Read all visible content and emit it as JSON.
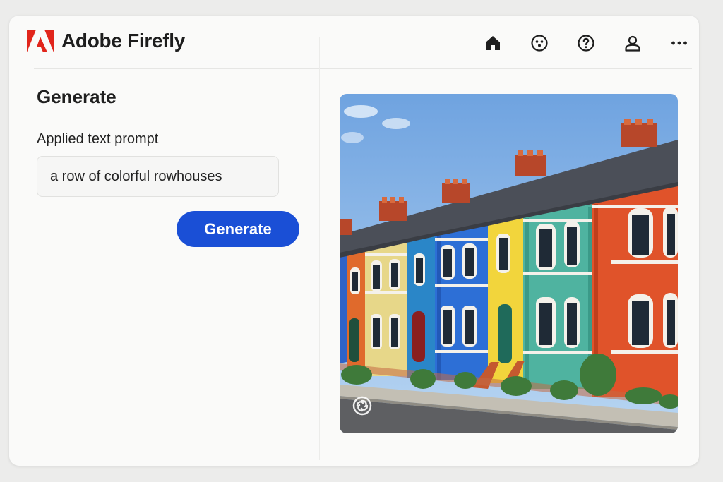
{
  "app": {
    "name": "Adobe Firefly",
    "logo": "adobe-logo",
    "logo_color": "#e1251b"
  },
  "nav": {
    "icons": [
      "home-icon",
      "face-icon",
      "help-icon",
      "user-icon",
      "more-icon"
    ]
  },
  "generate": {
    "title": "Generate",
    "prompt_label": "Applied text prompt",
    "prompt_value": "a row of colorful rowhouses",
    "button_label": "Generate",
    "button_color": "#1a4fd6"
  },
  "result": {
    "image": "generated-rowhouses-image",
    "overlay_icon": "firefly-swirl-icon"
  }
}
